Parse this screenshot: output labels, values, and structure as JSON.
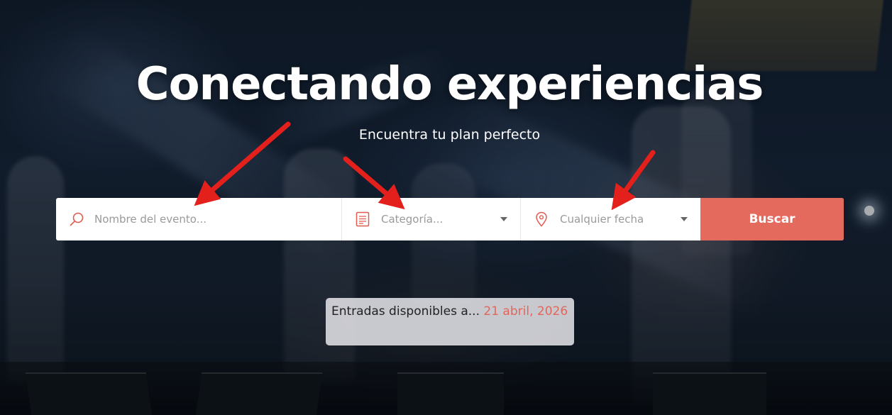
{
  "hero": {
    "title": "Conectando experiencias",
    "subtitle": "Encuentra tu plan perfecto"
  },
  "search": {
    "event_placeholder": "Nombre del evento...",
    "category_placeholder": "Categoría...",
    "date_placeholder": "Cualquier fecha",
    "button_label": "Buscar"
  },
  "tickets": {
    "label": "Entradas disponibles a...",
    "date": "21 abril, 2026"
  },
  "colors": {
    "accent": "#e46a5e",
    "arrow": "#e3201b",
    "icon": "#e05a4e"
  },
  "icons": {
    "event": "search-icon",
    "category": "list-icon",
    "date": "location-pin-icon",
    "dropdown": "caret-down-icon"
  }
}
